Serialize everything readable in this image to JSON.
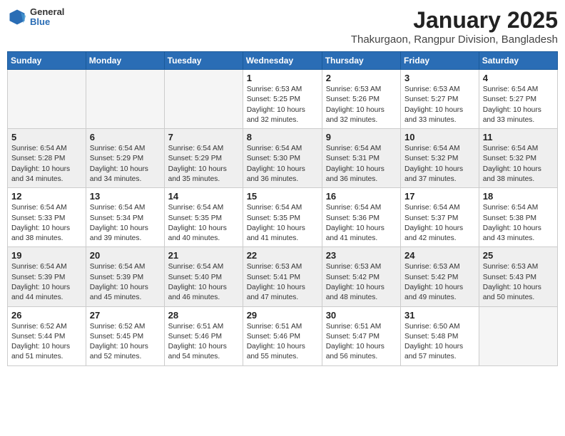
{
  "logo": {
    "general": "General",
    "blue": "Blue"
  },
  "title": "January 2025",
  "subtitle": "Thakurgaon, Rangpur Division, Bangladesh",
  "weekdays": [
    "Sunday",
    "Monday",
    "Tuesday",
    "Wednesday",
    "Thursday",
    "Friday",
    "Saturday"
  ],
  "weeks": [
    [
      {
        "day": "",
        "info": ""
      },
      {
        "day": "",
        "info": ""
      },
      {
        "day": "",
        "info": ""
      },
      {
        "day": "1",
        "info": "Sunrise: 6:53 AM\nSunset: 5:25 PM\nDaylight: 10 hours\nand 32 minutes."
      },
      {
        "day": "2",
        "info": "Sunrise: 6:53 AM\nSunset: 5:26 PM\nDaylight: 10 hours\nand 32 minutes."
      },
      {
        "day": "3",
        "info": "Sunrise: 6:53 AM\nSunset: 5:27 PM\nDaylight: 10 hours\nand 33 minutes."
      },
      {
        "day": "4",
        "info": "Sunrise: 6:54 AM\nSunset: 5:27 PM\nDaylight: 10 hours\nand 33 minutes."
      }
    ],
    [
      {
        "day": "5",
        "info": "Sunrise: 6:54 AM\nSunset: 5:28 PM\nDaylight: 10 hours\nand 34 minutes."
      },
      {
        "day": "6",
        "info": "Sunrise: 6:54 AM\nSunset: 5:29 PM\nDaylight: 10 hours\nand 34 minutes."
      },
      {
        "day": "7",
        "info": "Sunrise: 6:54 AM\nSunset: 5:29 PM\nDaylight: 10 hours\nand 35 minutes."
      },
      {
        "day": "8",
        "info": "Sunrise: 6:54 AM\nSunset: 5:30 PM\nDaylight: 10 hours\nand 36 minutes."
      },
      {
        "day": "9",
        "info": "Sunrise: 6:54 AM\nSunset: 5:31 PM\nDaylight: 10 hours\nand 36 minutes."
      },
      {
        "day": "10",
        "info": "Sunrise: 6:54 AM\nSunset: 5:32 PM\nDaylight: 10 hours\nand 37 minutes."
      },
      {
        "day": "11",
        "info": "Sunrise: 6:54 AM\nSunset: 5:32 PM\nDaylight: 10 hours\nand 38 minutes."
      }
    ],
    [
      {
        "day": "12",
        "info": "Sunrise: 6:54 AM\nSunset: 5:33 PM\nDaylight: 10 hours\nand 38 minutes."
      },
      {
        "day": "13",
        "info": "Sunrise: 6:54 AM\nSunset: 5:34 PM\nDaylight: 10 hours\nand 39 minutes."
      },
      {
        "day": "14",
        "info": "Sunrise: 6:54 AM\nSunset: 5:35 PM\nDaylight: 10 hours\nand 40 minutes."
      },
      {
        "day": "15",
        "info": "Sunrise: 6:54 AM\nSunset: 5:35 PM\nDaylight: 10 hours\nand 41 minutes."
      },
      {
        "day": "16",
        "info": "Sunrise: 6:54 AM\nSunset: 5:36 PM\nDaylight: 10 hours\nand 41 minutes."
      },
      {
        "day": "17",
        "info": "Sunrise: 6:54 AM\nSunset: 5:37 PM\nDaylight: 10 hours\nand 42 minutes."
      },
      {
        "day": "18",
        "info": "Sunrise: 6:54 AM\nSunset: 5:38 PM\nDaylight: 10 hours\nand 43 minutes."
      }
    ],
    [
      {
        "day": "19",
        "info": "Sunrise: 6:54 AM\nSunset: 5:39 PM\nDaylight: 10 hours\nand 44 minutes."
      },
      {
        "day": "20",
        "info": "Sunrise: 6:54 AM\nSunset: 5:39 PM\nDaylight: 10 hours\nand 45 minutes."
      },
      {
        "day": "21",
        "info": "Sunrise: 6:54 AM\nSunset: 5:40 PM\nDaylight: 10 hours\nand 46 minutes."
      },
      {
        "day": "22",
        "info": "Sunrise: 6:53 AM\nSunset: 5:41 PM\nDaylight: 10 hours\nand 47 minutes."
      },
      {
        "day": "23",
        "info": "Sunrise: 6:53 AM\nSunset: 5:42 PM\nDaylight: 10 hours\nand 48 minutes."
      },
      {
        "day": "24",
        "info": "Sunrise: 6:53 AM\nSunset: 5:42 PM\nDaylight: 10 hours\nand 49 minutes."
      },
      {
        "day": "25",
        "info": "Sunrise: 6:53 AM\nSunset: 5:43 PM\nDaylight: 10 hours\nand 50 minutes."
      }
    ],
    [
      {
        "day": "26",
        "info": "Sunrise: 6:52 AM\nSunset: 5:44 PM\nDaylight: 10 hours\nand 51 minutes."
      },
      {
        "day": "27",
        "info": "Sunrise: 6:52 AM\nSunset: 5:45 PM\nDaylight: 10 hours\nand 52 minutes."
      },
      {
        "day": "28",
        "info": "Sunrise: 6:51 AM\nSunset: 5:46 PM\nDaylight: 10 hours\nand 54 minutes."
      },
      {
        "day": "29",
        "info": "Sunrise: 6:51 AM\nSunset: 5:46 PM\nDaylight: 10 hours\nand 55 minutes."
      },
      {
        "day": "30",
        "info": "Sunrise: 6:51 AM\nSunset: 5:47 PM\nDaylight: 10 hours\nand 56 minutes."
      },
      {
        "day": "31",
        "info": "Sunrise: 6:50 AM\nSunset: 5:48 PM\nDaylight: 10 hours\nand 57 minutes."
      },
      {
        "day": "",
        "info": ""
      }
    ]
  ],
  "colors": {
    "header_bg": "#2a6db5",
    "header_text": "#ffffff",
    "shaded_row": "#efefef",
    "border": "#cccccc"
  }
}
